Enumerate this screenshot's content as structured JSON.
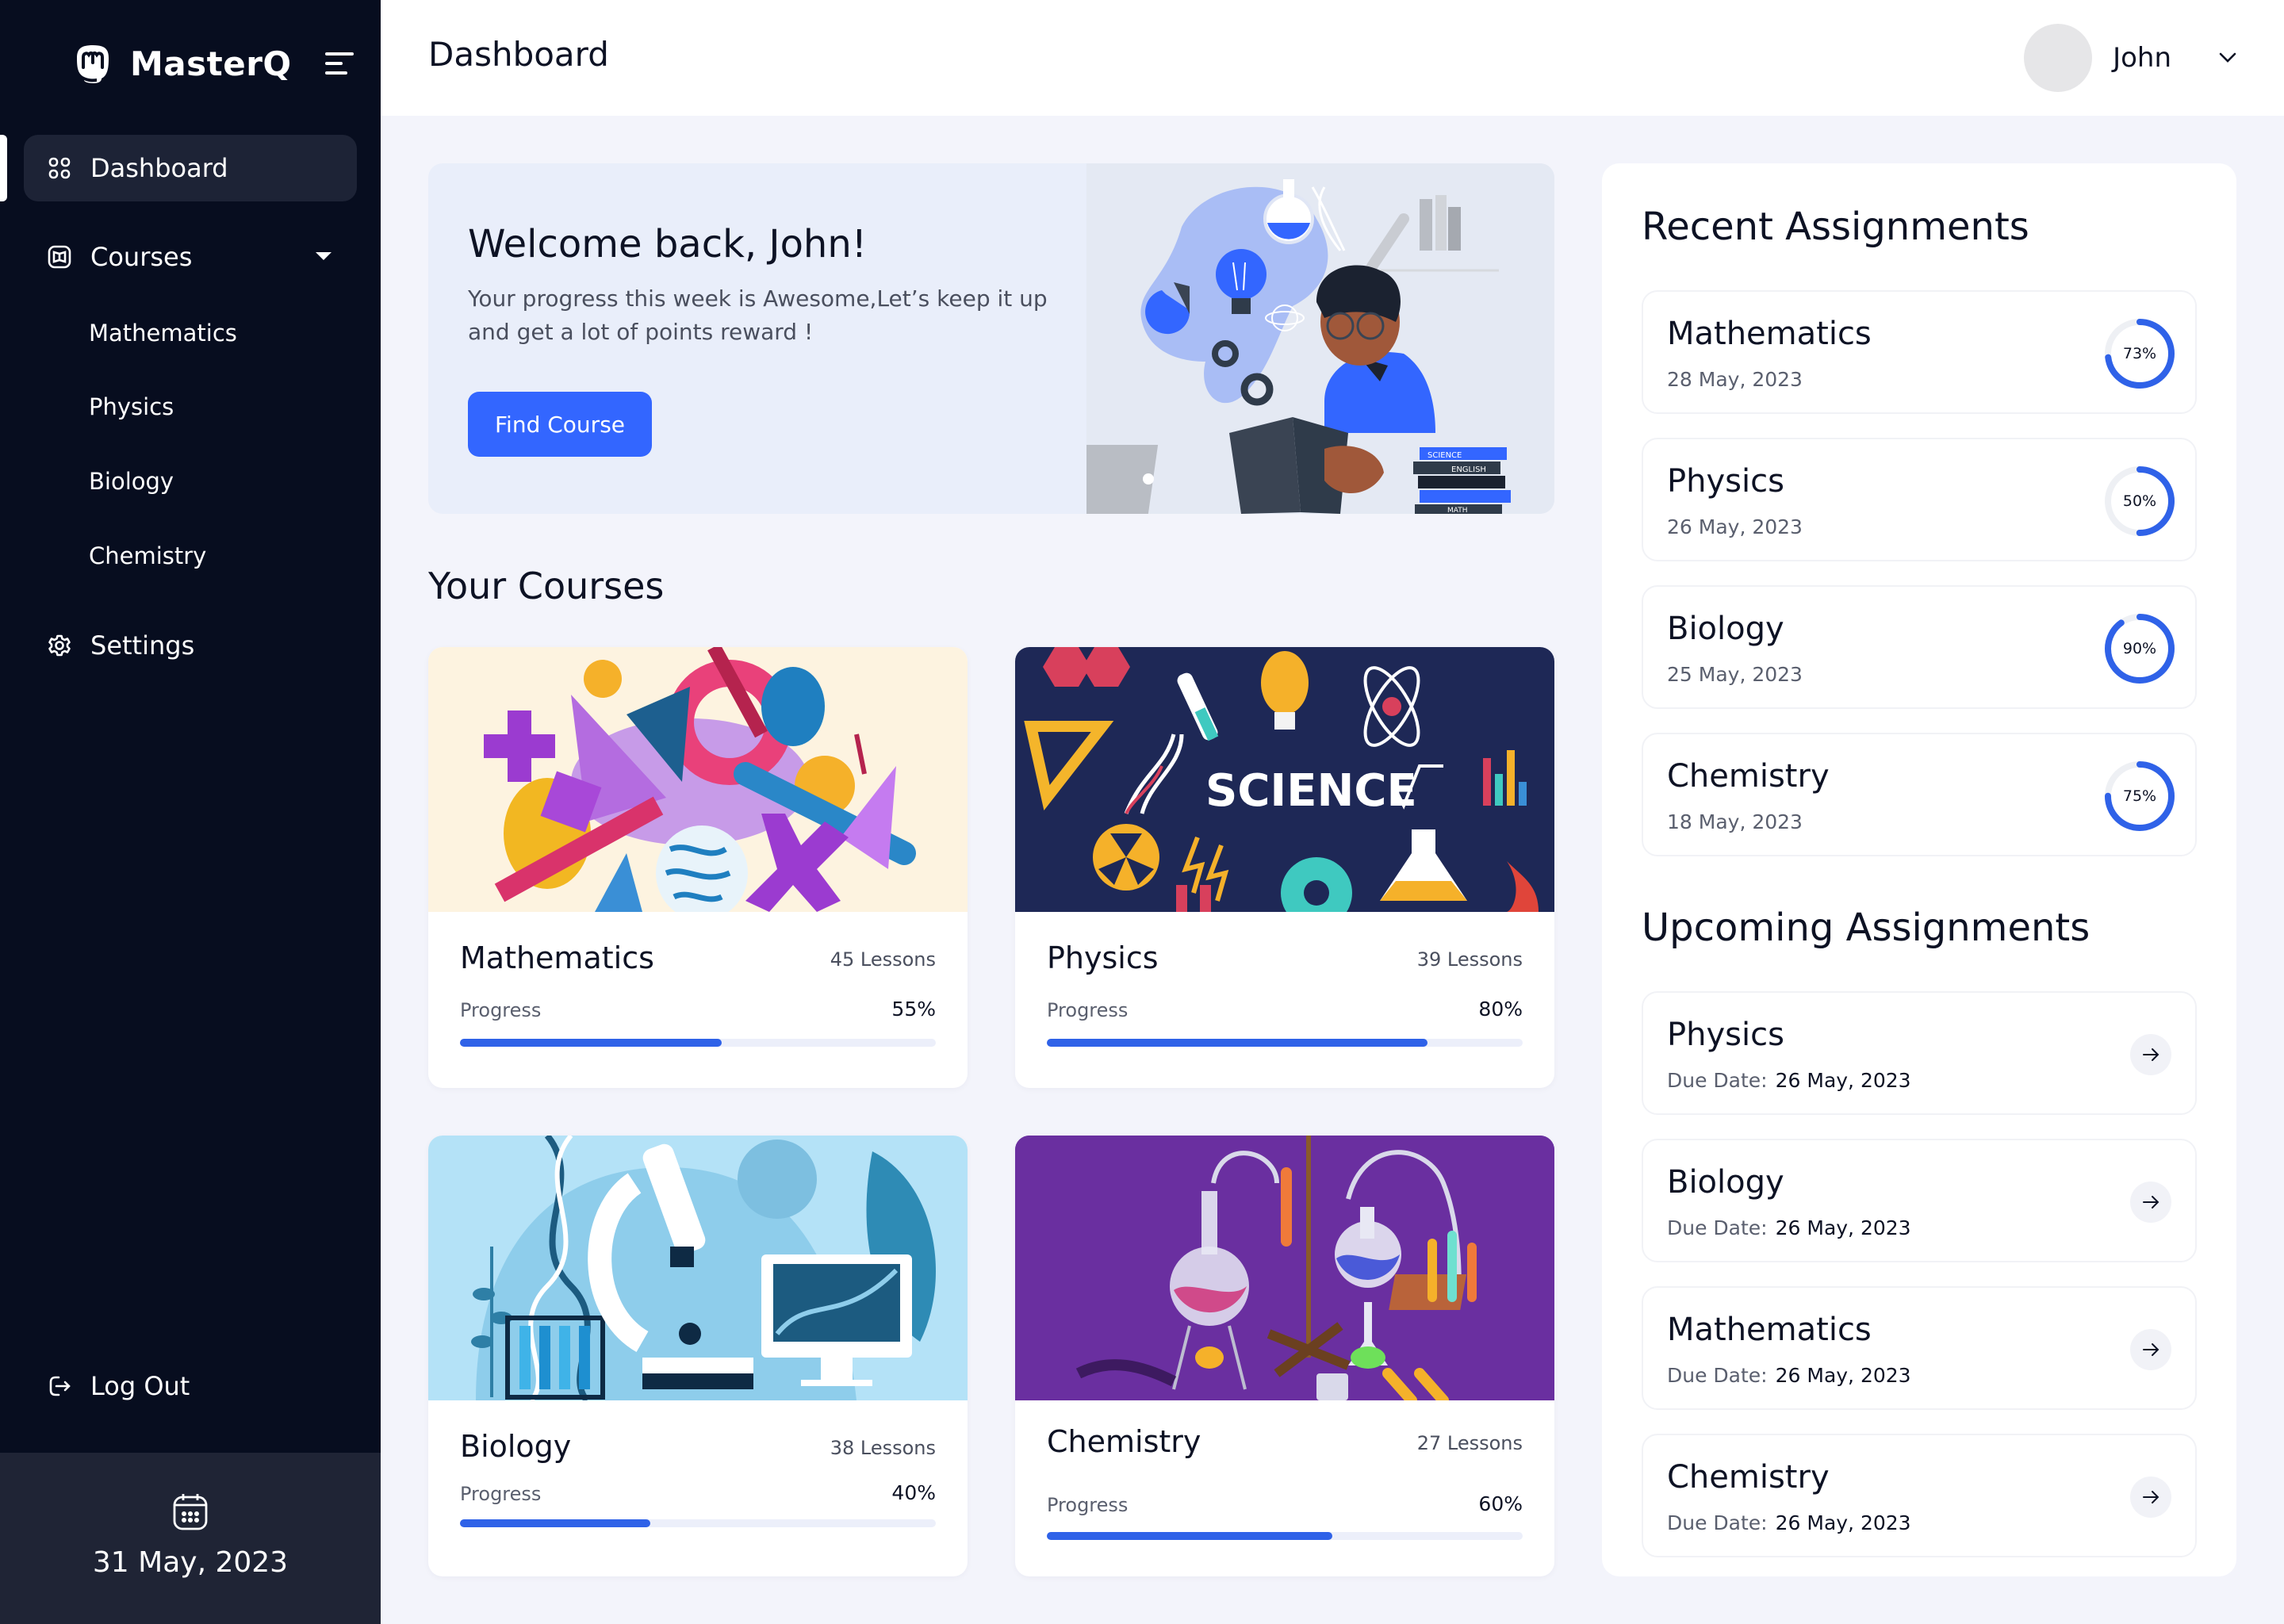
{
  "app": {
    "name": "MasterQ"
  },
  "colors": {
    "accent": "#3366ff",
    "progress": "#2f62e8",
    "sidebar_bg": "#070d1f",
    "sidebar_active": "#1d2336",
    "date_panel": "#1f2435",
    "page_bg": "#f3f4fb"
  },
  "sidebar": {
    "items": [
      {
        "label": "Dashboard",
        "icon": "grid-icon",
        "active": true
      },
      {
        "label": "Courses",
        "icon": "book-icon",
        "expanded": true,
        "children": [
          "Mathematics",
          "Physics",
          "Biology",
          "Chemistry"
        ]
      },
      {
        "label": "Settings",
        "icon": "gear-icon"
      }
    ],
    "logout_label": "Log Out",
    "current_date": "31 May, 2023"
  },
  "header": {
    "title": "Dashboard",
    "user_name": "John"
  },
  "welcome": {
    "title": "Welcome back, John!",
    "message": "Your progress this week is Awesome,Let’s keep it up and get a lot of points reward !",
    "button_label": "Find Course",
    "illustration_book_labels": [
      "SCIENCE",
      "ENGLISH",
      "MATH"
    ]
  },
  "courses": {
    "title": "Your Courses",
    "progress_label": "Progress",
    "items": [
      {
        "name": "Mathematics",
        "lessons": "45 Lessons",
        "progress": 55,
        "progress_text": "55%",
        "image_text": ""
      },
      {
        "name": "Physics",
        "lessons": "39 Lessons",
        "progress": 80,
        "progress_text": "80%",
        "image_text": "SCIENCE"
      },
      {
        "name": "Biology",
        "lessons": "38 Lessons",
        "progress": 40,
        "progress_text": "40%",
        "image_text": ""
      },
      {
        "name": "Chemistry",
        "lessons": "27 Lessons",
        "progress": 60,
        "progress_text": "60%",
        "image_text": ""
      }
    ]
  },
  "recent_assignments": {
    "title": "Recent Assignments",
    "items": [
      {
        "subject": "Mathematics",
        "date": "28 May, 2023",
        "score": 73,
        "score_text": "73%"
      },
      {
        "subject": "Physics",
        "date": "26 May, 2023",
        "score": 50,
        "score_text": "50%"
      },
      {
        "subject": "Biology",
        "date": "25 May, 2023",
        "score": 90,
        "score_text": "90%"
      },
      {
        "subject": "Chemistry",
        "date": "18 May, 2023",
        "score": 75,
        "score_text": "75%"
      }
    ]
  },
  "upcoming_assignments": {
    "title": "Upcoming Assignments",
    "due_label": "Due Date:",
    "items": [
      {
        "subject": "Physics",
        "due": "26 May, 2023"
      },
      {
        "subject": "Biology",
        "due": "26 May, 2023"
      },
      {
        "subject": "Mathematics",
        "due": "26 May, 2023"
      },
      {
        "subject": "Chemistry",
        "due": "26 May, 2023"
      }
    ]
  }
}
